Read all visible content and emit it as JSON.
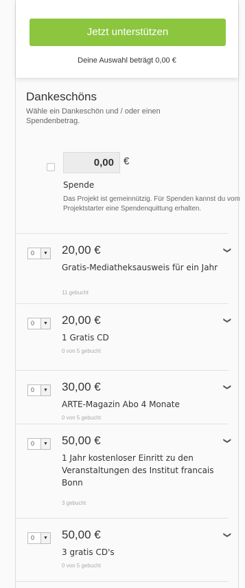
{
  "support": {
    "button_label": "Jetzt unterstützen",
    "selection_text": "Deine Auswahl beträgt 0,00 €"
  },
  "thanks": {
    "title": "Dankeschöns",
    "subtitle": "Wähle ein Dankeschön und / oder einen Spendenbetrag."
  },
  "donation": {
    "amount": "0,00",
    "currency": "€",
    "label": "Spende",
    "note": "Das Projekt ist gemeinnützig. Für Spenden kannst du vom Projektstarter eine Spendenquittung erhalten."
  },
  "rewards": [
    {
      "qty": "0",
      "price": "20,00 €",
      "title": "Gratis-Mediatheksausweis für ein Jahr",
      "booked": "11 gebucht"
    },
    {
      "qty": "0",
      "price": "20,00 €",
      "title": "1 Gratis CD",
      "booked": "0 von 5 gebucht"
    },
    {
      "qty": "0",
      "price": "30,00 €",
      "title": "ARTE-Magazin Abo 4 Monate",
      "booked": "0 von 5 gebucht"
    },
    {
      "qty": "0",
      "price": "50,00 €",
      "title": "1 Jahr kostenloser Einritt zu den Veranstaltungen des Institut francais Bonn",
      "booked": "3 gebucht"
    },
    {
      "qty": "0",
      "price": "50,00 €",
      "title": "3 gratis CD's",
      "booked": "0 von 5 gebucht"
    }
  ],
  "colors": {
    "accent": "#8cc63f",
    "panel": "#ffffff",
    "background": "#fafafa"
  },
  "icons": {
    "dropdown": "select-arrow-icon",
    "expand": "chevron-down-icon"
  }
}
